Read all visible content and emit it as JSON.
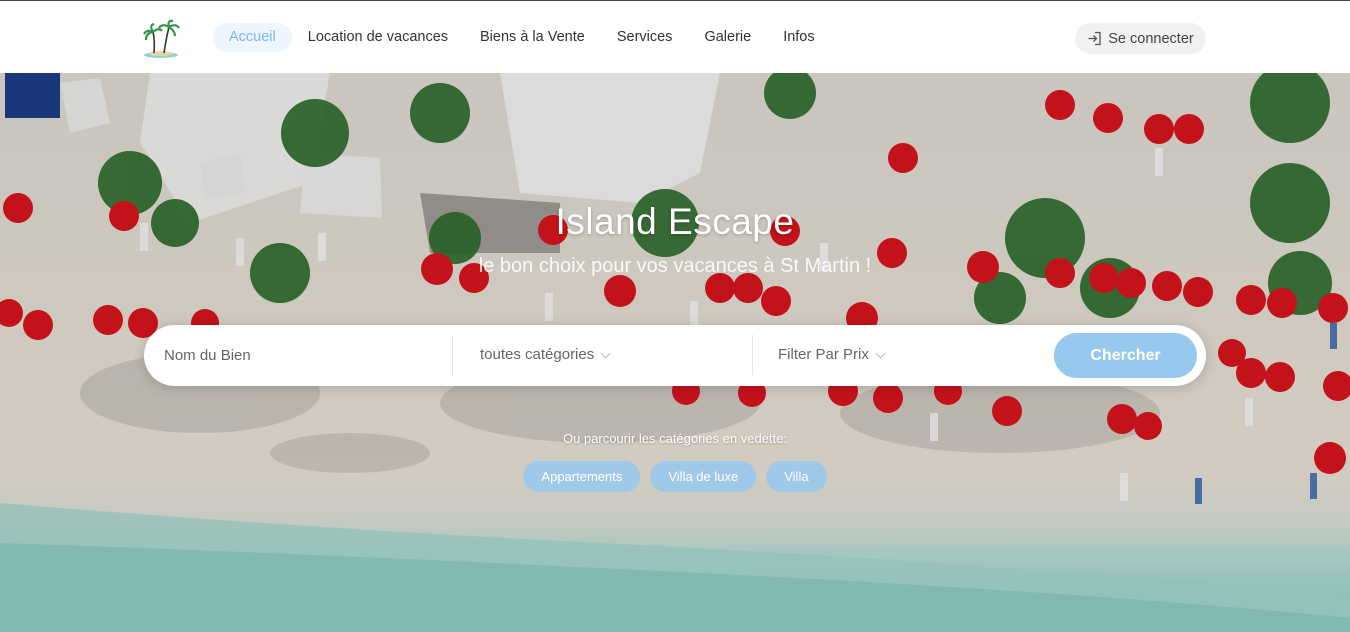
{
  "header": {
    "logo": "palm-tree-island-logo",
    "nav": [
      {
        "label": "Accueil",
        "active": true
      },
      {
        "label": "Location de vacances",
        "active": false
      },
      {
        "label": "Biens à la Vente",
        "active": false
      },
      {
        "label": "Services",
        "active": false
      },
      {
        "label": "Galerie",
        "active": false
      },
      {
        "label": "Infos",
        "active": false
      }
    ],
    "login_label": "Se connecter",
    "login_icon": "sign-in-icon"
  },
  "hero": {
    "title": "Island Escape",
    "subtitle": "le bon choix pour vos vacances à St Martin !",
    "background": "aerial-beach-red-umbrellas-photo"
  },
  "search": {
    "name_placeholder": "Nom du Bien",
    "category_value": "toutes catégories",
    "price_value": "Filter Par Prix",
    "button_label": "Chercher"
  },
  "browse": {
    "label": "Ou parcourir les catégories en vedette:",
    "tags": [
      "Appartements",
      "Villa de luxe",
      "Villa"
    ]
  },
  "colors": {
    "accent": "#97c8ee",
    "active_nav_bg": "#eef5fc",
    "active_nav_text": "#7ab8ea",
    "umbrella": "#e0151f",
    "sea": "#a9ddd6",
    "sand": "#ece6da"
  }
}
